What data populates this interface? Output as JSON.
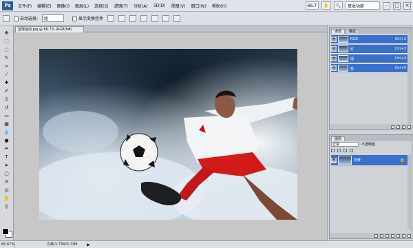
{
  "menubar": {
    "logo": "Ps",
    "items": [
      "文件(F)",
      "编辑(E)",
      "图像(I)",
      "图层(L)",
      "选择(S)",
      "滤镜(T)",
      "分析(A)",
      "3D(D)",
      "视图(V)",
      "窗口(W)",
      "帮助(H)"
    ],
    "zoom_label": "66.7",
    "workspace_label": "基本功能",
    "minimize": "–",
    "restore": "□",
    "close": "×"
  },
  "options": {
    "auto_select_label": "自动选择:",
    "auto_select_value": "组",
    "show_transform_label": "显示变换控件"
  },
  "document": {
    "tab_title": "足球运动.jpg @ 66.7% (RGB/8#)"
  },
  "status": {
    "zoom": "66.67%",
    "doc_info": "文档:3.73M/3.73M",
    "arrow": "▶"
  },
  "channels_panel": {
    "tabs": [
      "通道",
      "路径"
    ],
    "rows": [
      {
        "name": "RGB",
        "shortcut": "Ctrl+2"
      },
      {
        "name": "红",
        "shortcut": "Ctrl+3"
      },
      {
        "name": "绿",
        "shortcut": "Ctrl+4"
      },
      {
        "name": "蓝",
        "shortcut": "Ctrl+5"
      }
    ]
  },
  "layers_panel": {
    "tabs": [
      "图层"
    ],
    "blend_mode": "正常",
    "opacity_label": "不透明度",
    "layer_name": "背景",
    "lock_glyph": "🔒"
  },
  "colors": {
    "selection": "#3b6fc9",
    "canvas_bg": "#c7c7c7"
  }
}
